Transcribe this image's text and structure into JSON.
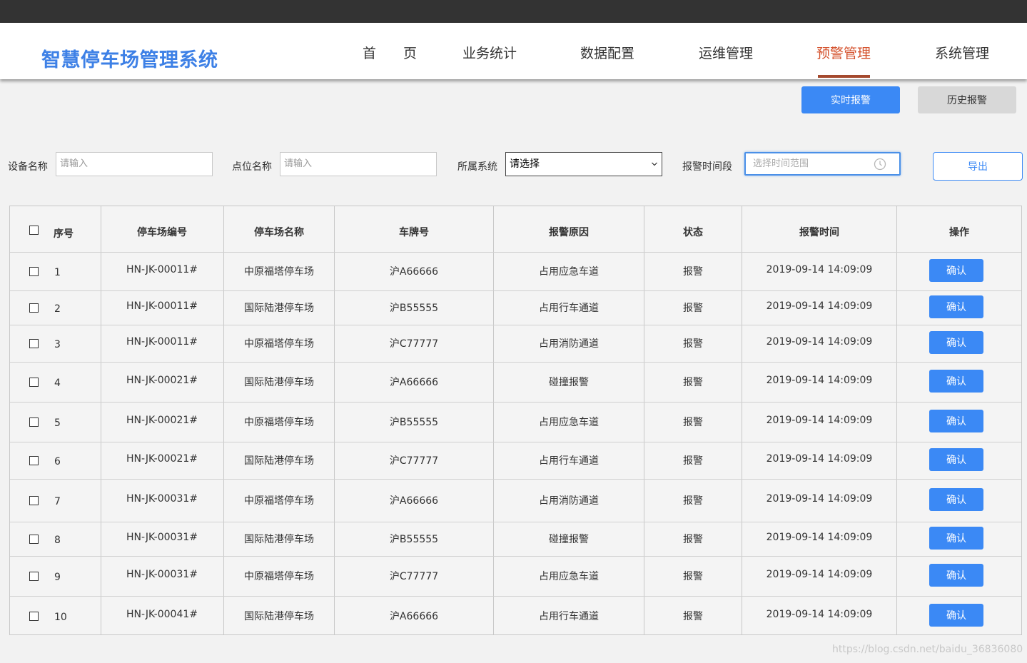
{
  "header": {
    "title": "智慧停车场管理系统",
    "nav": [
      {
        "label": "首　　页",
        "active": false
      },
      {
        "label": "业务统计",
        "active": false
      },
      {
        "label": "数据配置",
        "active": false
      },
      {
        "label": "运维管理",
        "active": false
      },
      {
        "label": "预警管理",
        "active": true
      },
      {
        "label": "系统管理",
        "active": false
      }
    ]
  },
  "tabs": {
    "realtime": "实时报警",
    "history": "历史报警"
  },
  "filters": {
    "device_label": "设备名称",
    "device_placeholder": "请输入",
    "point_label": "点位名称",
    "point_placeholder": "请输入",
    "system_label": "所属系统",
    "system_value": "请选择",
    "time_label": "报警时间段",
    "time_placeholder": "选择时间范围",
    "export": "导出"
  },
  "table": {
    "columns": [
      "序号",
      "停车场编号",
      "停车场名称",
      "车牌号",
      "报警原因",
      "状态",
      "报警时间",
      "操作"
    ],
    "confirm_label": "确认",
    "rows": [
      {
        "idx": "1",
        "code": "HN-JK-00011#",
        "name": "中原福塔停车场",
        "plate": "沪A66666",
        "reason": "占用应急车道",
        "status": "报警",
        "time": "2019-09-14 14:09:09"
      },
      {
        "idx": "2",
        "code": "HN-JK-00011#",
        "name": "国际陆港停车场",
        "plate": "沪B55555",
        "reason": "占用行车通道",
        "status": "报警",
        "time": "2019-09-14 14:09:09"
      },
      {
        "idx": "3",
        "code": "HN-JK-00011#",
        "name": "中原福塔停车场",
        "plate": "沪C77777",
        "reason": "占用消防通道",
        "status": "报警",
        "time": "2019-09-14 14:09:09"
      },
      {
        "idx": "4",
        "code": "HN-JK-00021#",
        "name": "国际陆港停车场",
        "plate": "沪A66666",
        "reason": "碰撞报警",
        "status": "报警",
        "time": "2019-09-14 14:09:09"
      },
      {
        "idx": "5",
        "code": "HN-JK-00021#",
        "name": "中原福塔停车场",
        "plate": "沪B55555",
        "reason": "占用应急车道",
        "status": "报警",
        "time": "2019-09-14 14:09:09"
      },
      {
        "idx": "6",
        "code": "HN-JK-00021#",
        "name": "国际陆港停车场",
        "plate": "沪C77777",
        "reason": "占用行车通道",
        "status": "报警",
        "time": "2019-09-14 14:09:09"
      },
      {
        "idx": "7",
        "code": "HN-JK-00031#",
        "name": "中原福塔停车场",
        "plate": "沪A66666",
        "reason": "占用消防通道",
        "status": "报警",
        "time": "2019-09-14 14:09:09"
      },
      {
        "idx": "8",
        "code": "HN-JK-00031#",
        "name": "国际陆港停车场",
        "plate": "沪B55555",
        "reason": "碰撞报警",
        "status": "报警",
        "time": "2019-09-14 14:09:09"
      },
      {
        "idx": "9",
        "code": "HN-JK-00031#",
        "name": "中原福塔停车场",
        "plate": "沪C77777",
        "reason": "占用应急车道",
        "status": "报警",
        "time": "2019-09-14 14:09:09"
      },
      {
        "idx": "10",
        "code": "HN-JK-00041#",
        "name": "国际陆港停车场",
        "plate": "沪A66666",
        "reason": "占用行车通道",
        "status": "报警",
        "time": "2019-09-14 14:09:09"
      }
    ]
  },
  "watermark": "https://blog.csdn.net/baidu_36836080",
  "colors": {
    "brand": "#3d80e6",
    "accent": "#3b89f5",
    "nav_active": "#d4512c"
  }
}
